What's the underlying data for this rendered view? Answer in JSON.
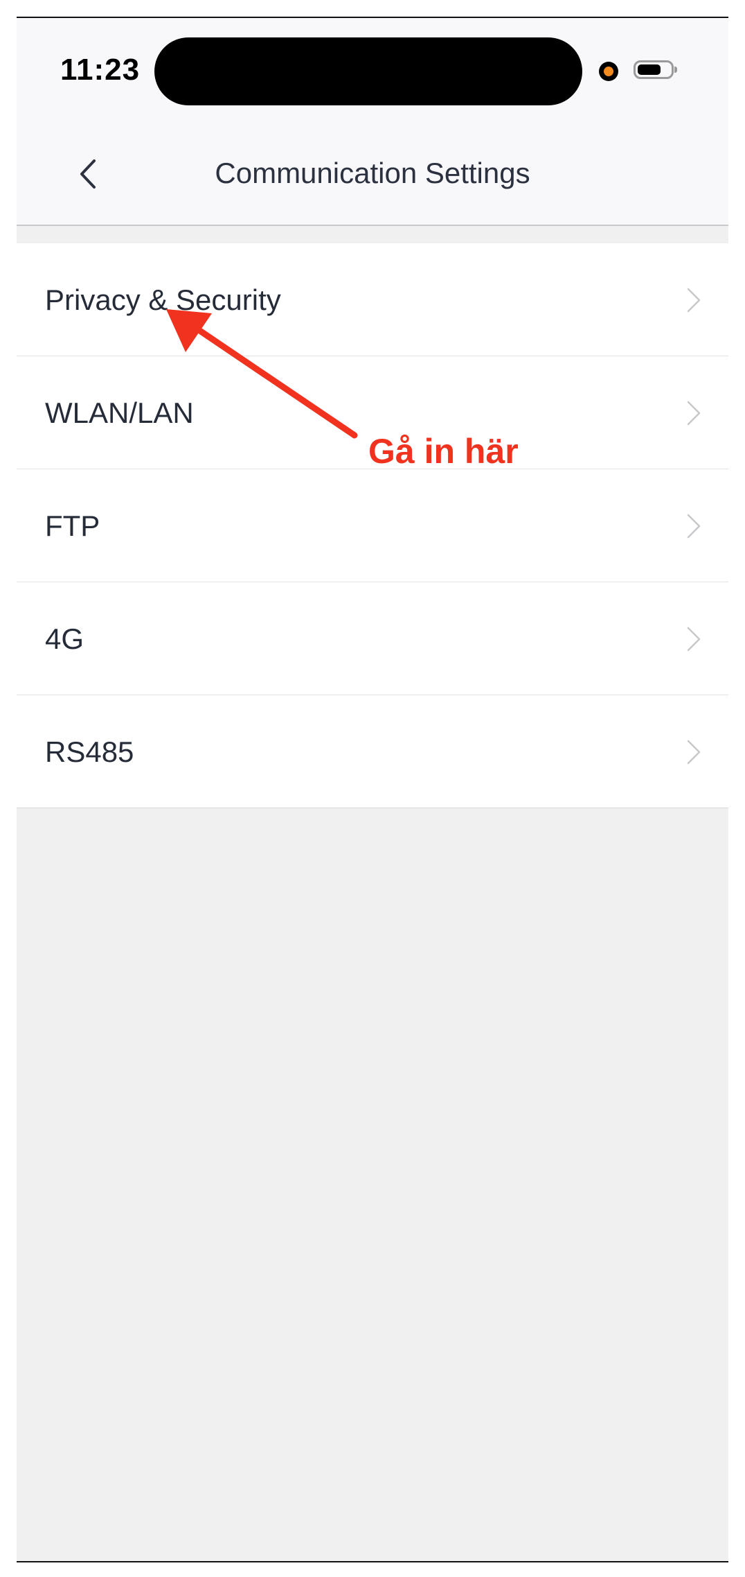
{
  "status_bar": {
    "time": "11:23"
  },
  "nav": {
    "title": "Communication Settings",
    "back_icon": "chevron-left-icon"
  },
  "settings_items": [
    {
      "label": "Privacy & Security",
      "icon": "chevron-right-icon"
    },
    {
      "label": "WLAN/LAN",
      "icon": "chevron-right-icon"
    },
    {
      "label": "FTP",
      "icon": "chevron-right-icon"
    },
    {
      "label": "4G",
      "icon": "chevron-right-icon"
    },
    {
      "label": "RS485",
      "icon": "chevron-right-icon"
    }
  ],
  "annotation": {
    "text": "Gå in här",
    "color": "#f0321e"
  },
  "colors": {
    "background": "#f0f0f0",
    "list_background": "#ffffff",
    "text": "#262b38",
    "accent_dot": "#f58a1f"
  }
}
